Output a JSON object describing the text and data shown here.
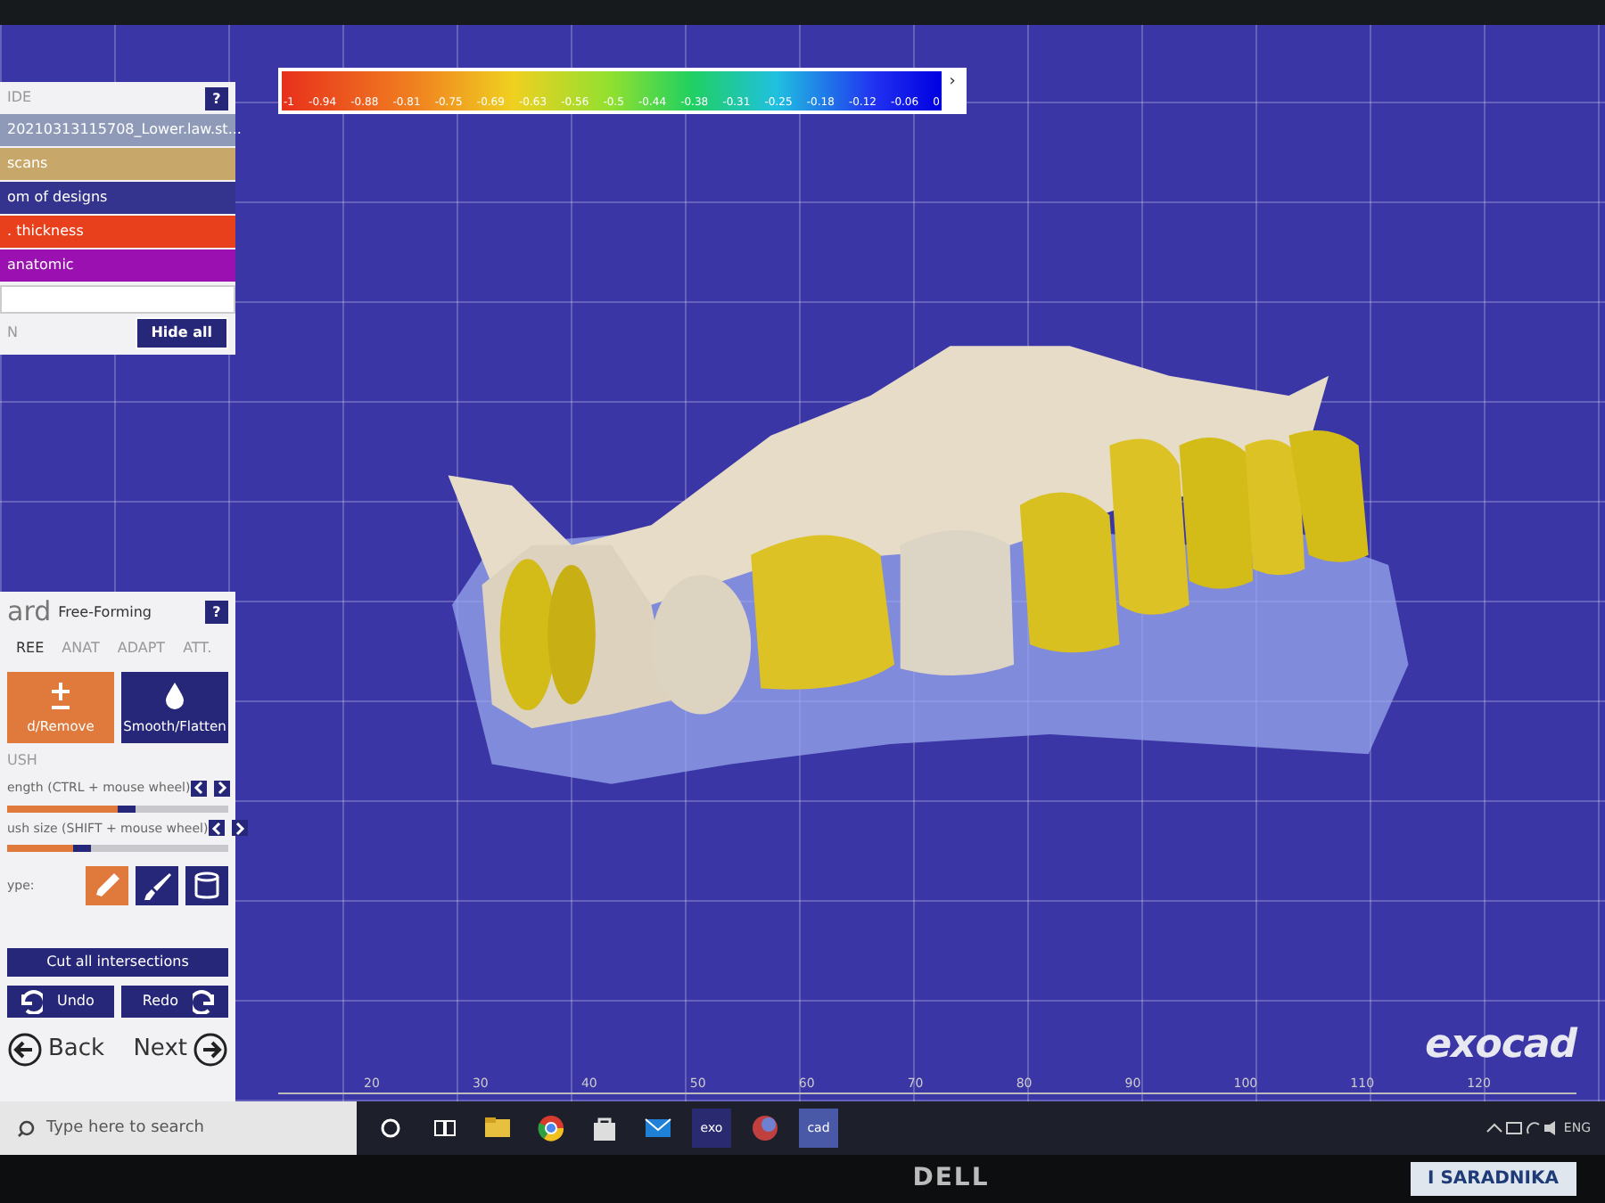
{
  "top_panel": {
    "header": "IDE",
    "help": "?",
    "items": [
      {
        "label": "20210313115708_Lower.law.st...",
        "color": "#8e9ab8"
      },
      {
        "label": "scans",
        "color": "#c8a86a"
      },
      {
        "label": "om of designs",
        "color": "#34348e"
      },
      {
        "label": ". thickness",
        "color": "#e8401c"
      },
      {
        "label": "anatomic",
        "color": "#9a10b0"
      }
    ],
    "footer_label": "N",
    "hide_all": "Hide all"
  },
  "color_scale": {
    "labels": [
      "-1",
      "-0.94",
      "-0.88",
      "-0.81",
      "-0.75",
      "-0.69",
      "-0.63",
      "-0.56",
      "-0.5",
      "-0.44",
      "-0.38",
      "-0.31",
      "-0.25",
      "-0.18",
      "-0.12",
      "-0.06",
      "0"
    ],
    "next": "›"
  },
  "wizard": {
    "title": "ard",
    "subtitle": "Free-Forming",
    "help": "?",
    "tabs": [
      {
        "label": "REE",
        "selected": true
      },
      {
        "label": "ANAT",
        "selected": false
      },
      {
        "label": "ADAPT",
        "selected": false
      },
      {
        "label": "ATT.",
        "selected": false
      }
    ],
    "tools": [
      {
        "label": "d/Remove",
        "selected": true
      },
      {
        "label": "Smooth/Flatten",
        "selected": false
      }
    ],
    "section": "USH",
    "sliders": [
      {
        "label": "ength (CTRL + mouse wheel)",
        "level": 0.5
      },
      {
        "label": "ush size (SHIFT + mouse wheel)",
        "level": 0.3
      }
    ],
    "type_label": "ype:",
    "types": [
      {
        "selected": true
      },
      {
        "selected": false
      },
      {
        "selected": false
      }
    ],
    "cut_button": "Cut all intersections",
    "undo": "Undo",
    "redo": "Redo",
    "back": "Back",
    "next": "Next"
  },
  "ruler": {
    "labels": [
      "20",
      "30",
      "40",
      "50",
      "60",
      "70",
      "80",
      "90",
      "100",
      "110",
      "120"
    ]
  },
  "logo": "exocad",
  "taskbar": {
    "search_placeholder": "Type here to search",
    "apps": [
      {
        "kind": "folder",
        "selected": false
      },
      {
        "kind": "browser",
        "selected": false
      },
      {
        "kind": "store",
        "selected": false
      },
      {
        "kind": "mail",
        "selected": false
      },
      {
        "kind": "text",
        "label": "exo",
        "selected": false
      },
      {
        "kind": "orb",
        "selected": false
      },
      {
        "kind": "text",
        "label": "cad",
        "selected": true
      }
    ],
    "tray": "ENG"
  },
  "monitor": {
    "brand": "DELL"
  },
  "sign": {
    "text": "I SARADNIKA"
  }
}
